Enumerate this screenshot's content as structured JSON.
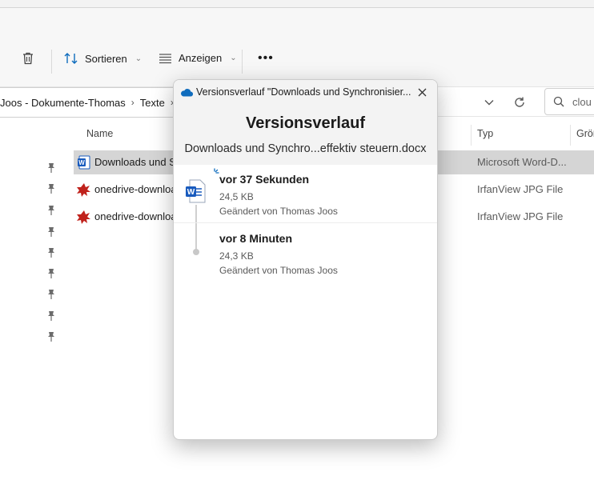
{
  "toolbar": {
    "sort_label": "Sortieren",
    "view_label": "Anzeigen",
    "more_label": "•••"
  },
  "addressbar": {
    "breadcrumbs": [
      "Joos - Dokumente-Thomas",
      "Texte"
    ],
    "search_value": "clou"
  },
  "columns": {
    "name": "Name",
    "type": "Typ",
    "size": "Größ"
  },
  "files": [
    {
      "name": "Downloads und Synchronisieren",
      "type": "Microsoft Word-D...",
      "icon": "word-doc-icon",
      "selected": true
    },
    {
      "name": "onedrive-download",
      "type": "IrfanView JPG File",
      "icon": "irfanview-icon",
      "selected": false
    },
    {
      "name": "onedrive-download",
      "type": "IrfanView JPG File",
      "icon": "irfanview-icon",
      "selected": false
    }
  ],
  "flyout": {
    "window_title": "Versionsverlauf \"Downloads und Synchronisier...",
    "heading": "Versionsverlauf",
    "filename": "Downloads und Synchro...effektiv steuern.docx",
    "versions": [
      {
        "time": "vor 37 Sekunden",
        "size": "24,5 KB",
        "modified_by": "Geändert von Thomas Joos"
      },
      {
        "time": "vor 8 Minuten",
        "size": "24,3 KB",
        "modified_by": "Geändert von Thomas Joos"
      }
    ]
  },
  "colors": {
    "accent": "#0f6cbd",
    "word_blue": "#185abd",
    "irfan_red": "#c0221c",
    "selection": "#d5d5d5"
  }
}
